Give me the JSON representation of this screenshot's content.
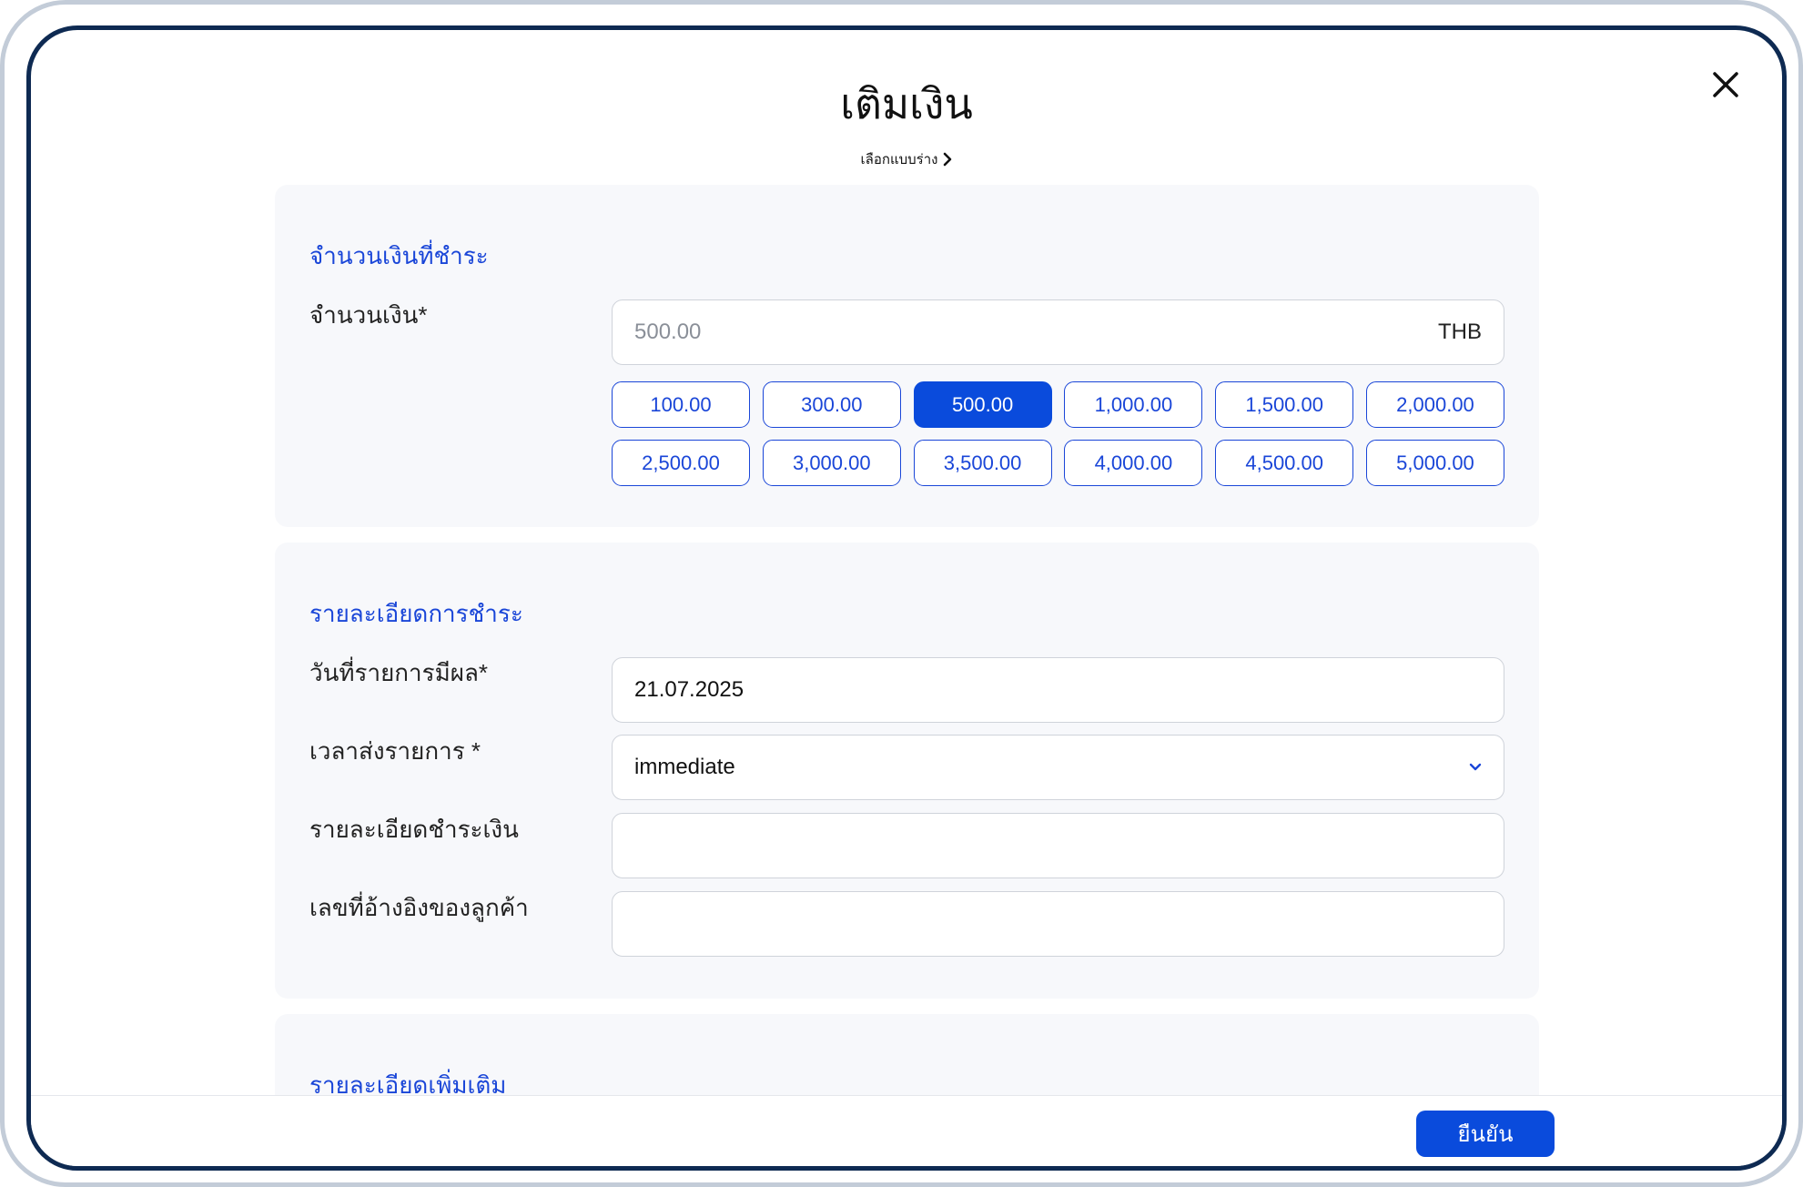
{
  "modal": {
    "title": "เติมเงิน",
    "template_link": "เลือกแบบร่าง",
    "close_icon": "close-icon"
  },
  "amount_section": {
    "title": "จำนวนเงินที่ชำระ",
    "amount_label": "จำนวนเงิน*",
    "amount_placeholder": "500.00",
    "currency": "THB",
    "quick_amounts": [
      "100.00",
      "300.00",
      "500.00",
      "1,000.00",
      "1,500.00",
      "2,000.00",
      "2,500.00",
      "3,000.00",
      "3,500.00",
      "4,000.00",
      "4,500.00",
      "5,000.00"
    ],
    "selected_amount": "500.00"
  },
  "payment_section": {
    "title": "รายละเอียดการชำระ",
    "effective_date_label": "วันที่รายการมีผล*",
    "effective_date_value": "21.07.2025",
    "send_time_label": "เวลาส่งรายการ *",
    "send_time_value": "immediate",
    "payment_details_label": "รายละเอียดชำระเงิน",
    "payment_details_value": "",
    "customer_ref_label": "เลขที่อ้างอิงของลูกค้า",
    "customer_ref_value": ""
  },
  "extra_section": {
    "title": "รายละเอียดเพิ่มเติม"
  },
  "footer": {
    "confirm_label": "ยืนยัน"
  },
  "colors": {
    "accent": "#0a4bdc",
    "section_title": "#1a46d8",
    "section_bg": "#f7f8fb",
    "frame_outer": "#c3ccd8",
    "frame_inner": "#0e2a52"
  }
}
